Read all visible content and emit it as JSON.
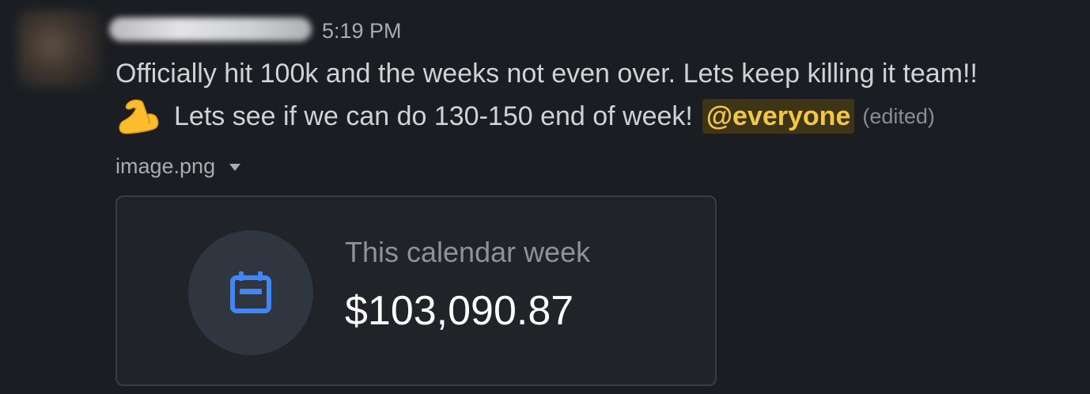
{
  "message": {
    "timestamp": "5:19 PM",
    "text_line1": "Officially hit 100k and the weeks not even over. Lets keep killing it team!!",
    "text_line2": "Lets see if we can do 130-150 end of week!",
    "emoji": "flexed-biceps-emoji",
    "mention": "@everyone",
    "edited": "(edited)"
  },
  "attachment": {
    "file_name": "image.png",
    "card": {
      "label": "This calendar week",
      "value": "$103,090.87",
      "icon": "calendar-icon",
      "icon_color": "#4285f4"
    }
  },
  "colors": {
    "background": "#1a1d21",
    "mention_bg": "#3e3417",
    "mention_text": "#f2c744"
  }
}
